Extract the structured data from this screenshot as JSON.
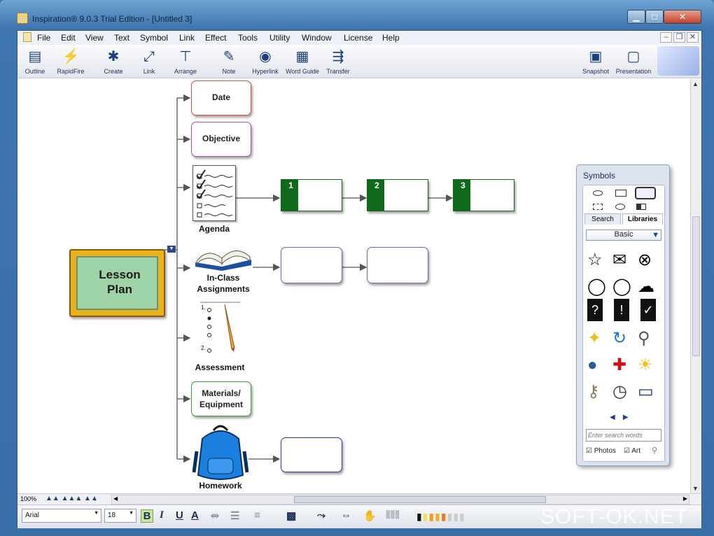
{
  "window": {
    "title": "Inspiration® 9.0.3 Trial Edition - [Untitled 3]"
  },
  "menus": [
    "File",
    "Edit",
    "View",
    "Text",
    "Symbol",
    "Link",
    "Effect",
    "Tools",
    "Utility",
    "Window",
    "License",
    "Help"
  ],
  "toolbar": {
    "outline": "Outline",
    "rapidfire": "RapidFire",
    "create": "Create",
    "link": "Link",
    "arrange": "Arrange",
    "note": "Note",
    "hyperlink": "Hyperlink",
    "wordguide": "Word Guide",
    "transfer": "Transfer",
    "snapshot": "Snapshot",
    "presentation": "Presentation"
  },
  "diagram": {
    "main": "Lesson Plan",
    "date": "Date",
    "objective": "Objective",
    "agenda": "Agenda",
    "inclass": "In-Class Assignments",
    "assessment": "Assessment",
    "materials": "Materials/ Equipment",
    "homework": "Homework",
    "steps": [
      "1",
      "2",
      "3"
    ],
    "checklist_marks": [
      "1.",
      "2."
    ]
  },
  "symbols": {
    "title": "Symbols",
    "tab_search": "Search",
    "tab_libraries": "Libraries",
    "library": "Basic",
    "search_placeholder": "Enter search words",
    "photos": "Photos",
    "art": "Art"
  },
  "status": {
    "zoom": "100%"
  },
  "format": {
    "font": "Arial",
    "size": "18",
    "bold": "B",
    "italic": "I",
    "underline": "U",
    "textcolor": "A"
  },
  "watermark": "SOFT-OK.NET",
  "colors": {
    "green": "#0f6a1c",
    "board": "#9dd3a6",
    "frame": "#e8b21c"
  }
}
